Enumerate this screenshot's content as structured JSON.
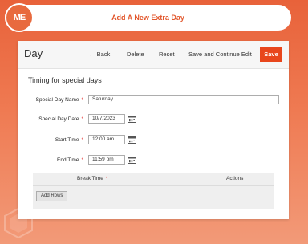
{
  "banner": {
    "title": "Add A New Extra Day",
    "logo_text": "ME"
  },
  "header": {
    "title": "Day",
    "back": "← Back",
    "delete": "Delete",
    "reset": "Reset",
    "save_continue": "Save and Continue Edit",
    "save": "Save"
  },
  "form": {
    "section_title": "Timing for special days",
    "fields": {
      "name": {
        "label": "Special Day Name",
        "value": "Saturday"
      },
      "date": {
        "label": "Special Day Date",
        "value": "10/7/2023"
      },
      "start": {
        "label": "Start Time",
        "value": "12:00 am"
      },
      "end": {
        "label": "End Time",
        "value": "11:59 pm"
      }
    },
    "required_mark": "*"
  },
  "grid": {
    "col_break": "Break Time",
    "col_actions": "Actions",
    "add_rows": "Add Rows"
  },
  "colors": {
    "accent": "#e8461c",
    "brand_orange": "#e8623a"
  }
}
